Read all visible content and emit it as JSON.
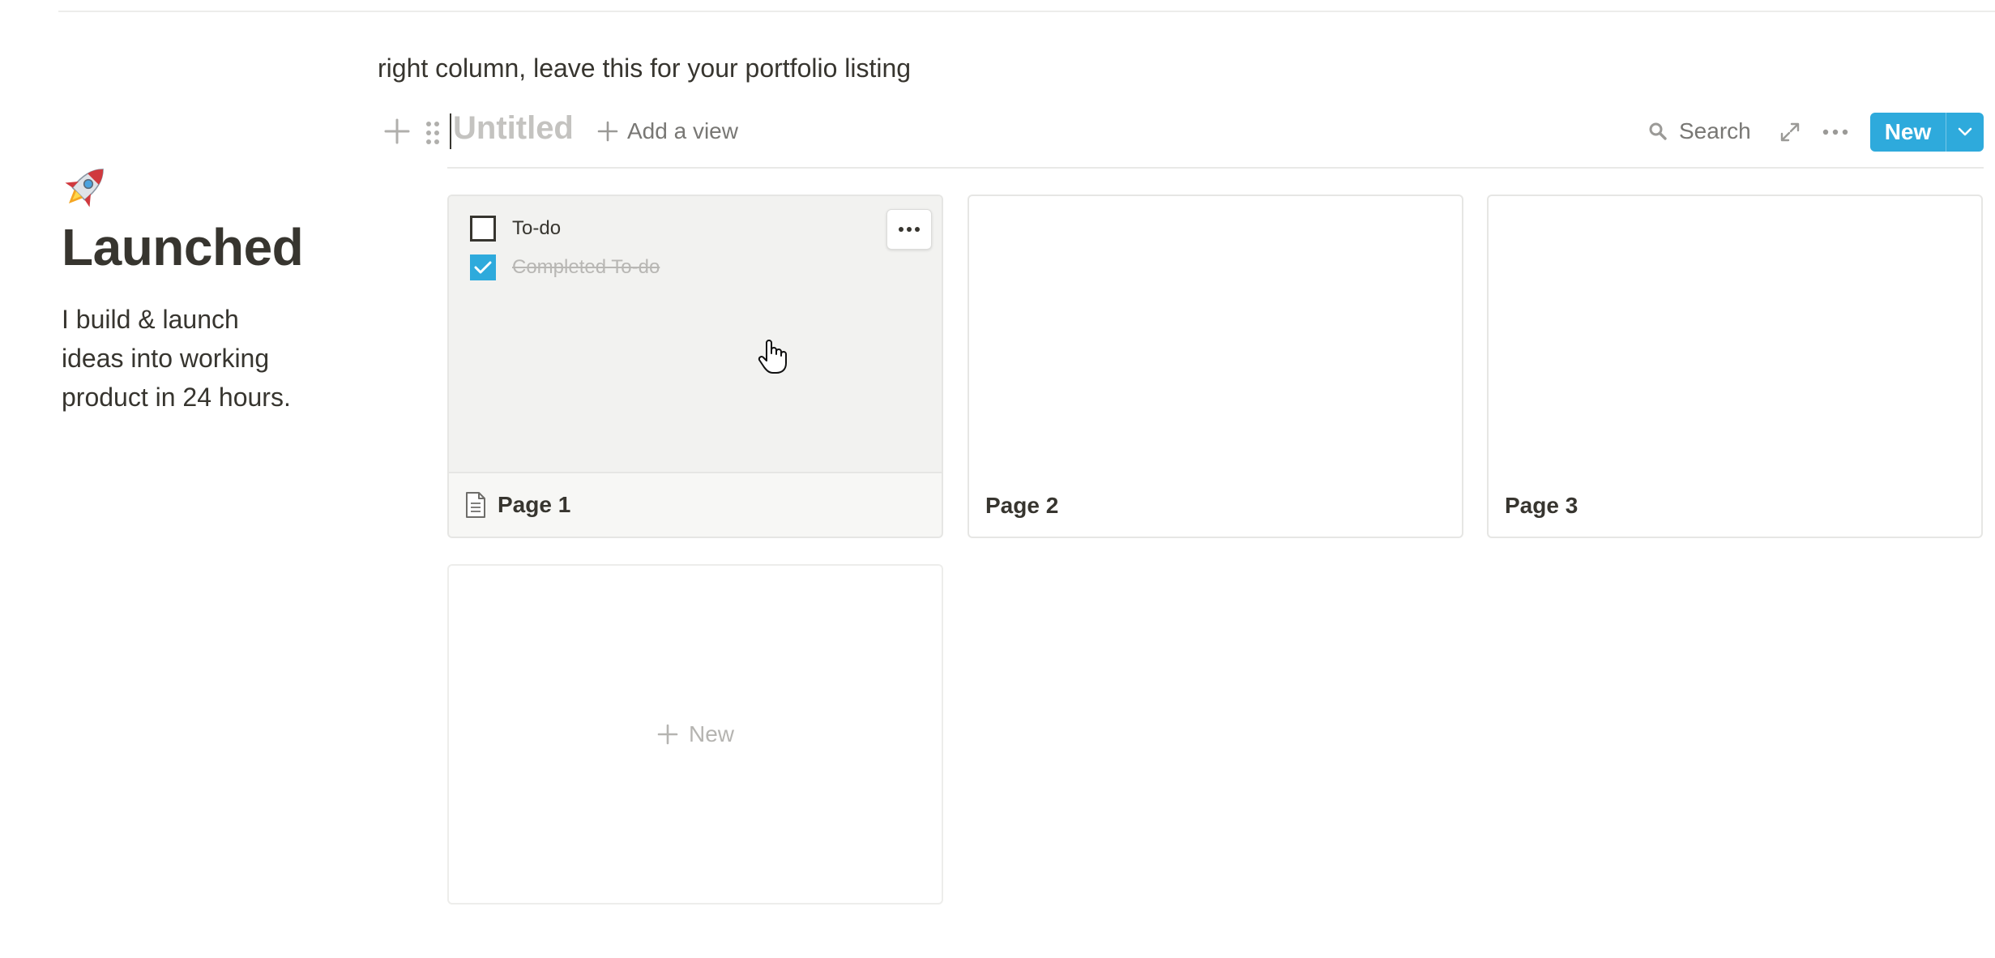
{
  "page": {
    "emoji": "🚀",
    "title": "Launched",
    "intro": "I build & launch ideas into working product in 24 hours."
  },
  "note": "right column, leave this for your portfolio listing",
  "database": {
    "title_placeholder": "Untitled",
    "add_view_label": "Add a view",
    "search_label": "Search",
    "new_button_label": "New"
  },
  "gallery": {
    "cards": [
      {
        "title": "Page 1",
        "todos": [
          {
            "label": "To-do",
            "checked": false
          },
          {
            "label": "Completed To-do",
            "checked": true
          }
        ]
      },
      {
        "title": "Page 2"
      },
      {
        "title": "Page 3"
      }
    ],
    "add_new_label": "New"
  },
  "colors": {
    "accent": "#2eaadc",
    "text": "#37352f",
    "muted": "#787774",
    "placeholder": "#c4c3c0",
    "border": "#e6e6e4"
  }
}
